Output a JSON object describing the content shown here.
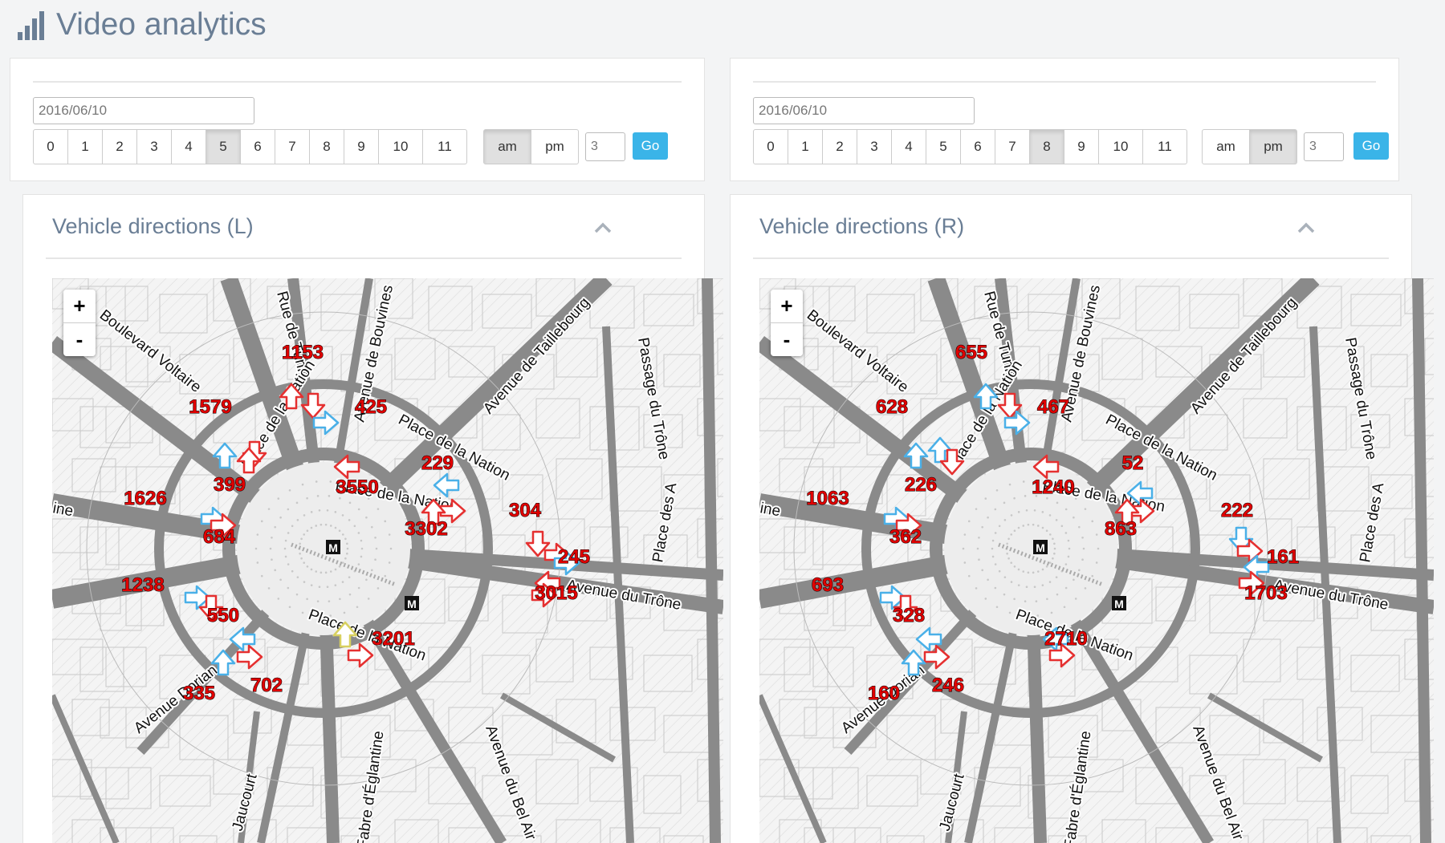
{
  "page_title": "Video analytics",
  "left": {
    "date": "2016/06/10",
    "hours": [
      "0",
      "1",
      "2",
      "3",
      "4",
      "5",
      "6",
      "7",
      "8",
      "9",
      "10",
      "11"
    ],
    "active_hour": 5,
    "am_label": "am",
    "pm_label": "pm",
    "active_period": "am",
    "count_value": "3",
    "go_label": "Go",
    "panel_title": "Vehicle directions (L)",
    "counts": [
      "1153",
      "425",
      "1579",
      "399",
      "1626",
      "684",
      "1238",
      "550",
      "335",
      "702",
      "229",
      "3550",
      "304",
      "3302",
      "245",
      "3015",
      "3201"
    ]
  },
  "right": {
    "date": "2016/06/10",
    "hours": [
      "0",
      "1",
      "2",
      "3",
      "4",
      "5",
      "6",
      "7",
      "8",
      "9",
      "10",
      "11"
    ],
    "active_hour": 8,
    "am_label": "am",
    "pm_label": "pm",
    "active_period": "pm",
    "count_value": "3",
    "go_label": "Go",
    "panel_title": "Vehicle directions (R)",
    "counts": [
      "655",
      "467",
      "628",
      "226",
      "1063",
      "362",
      "693",
      "328",
      "160",
      "246",
      "52",
      "1240",
      "222",
      "863",
      "161",
      "1703",
      "2710"
    ]
  },
  "map": {
    "zoom_in": "+",
    "zoom_out": "-",
    "metro": "M",
    "streets": {
      "voltaire": "Boulevard Voltaire",
      "tunis": "Rue de Tunis",
      "bouvines": "Avenue de Bouvines",
      "taillebourg": "Avenue de Taillebourg",
      "passage": "Passage du Trône",
      "place_des": "Place des A",
      "nation_ne": "Place de la Nation",
      "nation_w": "Place de la Nation",
      "nation_inner": "Place de la Nation",
      "nation_s": "Place de la Nation",
      "trone": "Avenue du Trône",
      "dorian": "Avenue Dorian",
      "jaucourt": "Jaucourt",
      "eglantine": "Fabre d'Églantine",
      "belair": "Avenue du Bel Air",
      "ine": "ine"
    }
  },
  "colors": {
    "accent": "#3ab4e8",
    "title": "#6a7e95",
    "count_text": "#e00000",
    "arrow_red": "#e53030",
    "arrow_blue": "#4ab0e8",
    "road": "#8a8a8a"
  }
}
